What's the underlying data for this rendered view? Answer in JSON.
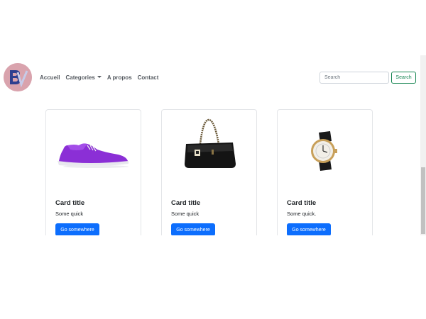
{
  "navbar": {
    "logo_icon": "bv-logo-icon",
    "links": [
      {
        "label": "Accueil"
      },
      {
        "label": "Categories",
        "dropdown": true
      },
      {
        "label": "A propos"
      },
      {
        "label": "Contact"
      }
    ],
    "search": {
      "placeholder": "Search",
      "button_label": "Search"
    }
  },
  "cards": [
    {
      "image": "sneaker-image",
      "title": "Card title",
      "text": "Some quick",
      "button": "Go somewhere"
    },
    {
      "image": "handbag-image",
      "title": "Card title",
      "text": "Some quick",
      "button": "Go somewhere"
    },
    {
      "image": "watch-image",
      "title": "Card title",
      "text": "Some quick.",
      "button": "Go somewhere"
    }
  ],
  "colors": {
    "primary": "#0d6efd",
    "success": "#198754",
    "logo_bg": "#d9a3ad"
  }
}
